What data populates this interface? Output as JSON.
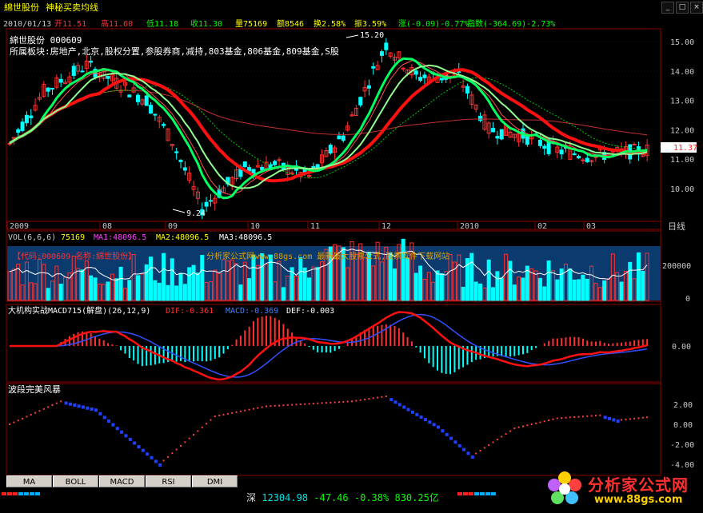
{
  "header": {
    "stock_name": "綿世股份",
    "formula_name": "神秘买卖均线",
    "window_buttons": [
      "_",
      "□",
      "×"
    ]
  },
  "quote_line": {
    "date": "2010/01/13",
    "open": "开11.51",
    "high": "高11.60",
    "low": "低11.18",
    "close": "收11.30",
    "volume": "量75169",
    "amount": "额8546",
    "turnover": "换2.58%",
    "amplitude": "振3.59%",
    "change": "涨(-0.09)-0.77%",
    "index": "指数(-364.69)-2.73%"
  },
  "info_overlay": {
    "code_line": "綿世股份 000609",
    "sector_line": "所属板块:房地产,北京,股权分置,参股券商,减持,803基金,806基金,809基金,S股"
  },
  "main_chart": {
    "price_axis": [
      "15.00",
      "14.00",
      "13.00",
      "12.00",
      "11.00",
      "10.00"
    ],
    "current_price": "11.37",
    "high_marker": "15.20",
    "low_marker": "9.24",
    "month_labels": [
      "2009",
      "08",
      "09",
      "10",
      "11",
      "12",
      "2010",
      "02",
      "03"
    ],
    "period_label": "日线"
  },
  "vol_panel": {
    "title": "VOL(6,6,6)",
    "value": "75169",
    "ma1": "MA1:48096.5",
    "ma2": "MA2:48096.5",
    "ma3": "MA3:48096.5",
    "axis": [
      "200000",
      "0"
    ],
    "code_label": "【代码:000609 名称:綿世股份】",
    "ad_text": "分析家公式网www.88gs.com 最新最大股票公式,股票软件下载网站"
  },
  "macd_panel": {
    "title": "大机构实战MACD715(解盘)(26,12,9)",
    "dif": "DIF:-0.361",
    "macd": "MACD:-0.369",
    "def": "DEF:-0.003",
    "axis": [
      "0.00"
    ]
  },
  "wave_panel": {
    "title": "波段完美风暴",
    "axis": [
      "2.00",
      "0.00",
      "-2.00",
      "-4.00"
    ]
  },
  "bottom_tabs": [
    "MA",
    "BOLL",
    "MACD",
    "RSI",
    "DMI"
  ],
  "status_bar": {
    "market": "深",
    "index_value": "12304.98",
    "change": "-47.46",
    "percent": "-0.38%",
    "amount": "830.25亿"
  },
  "logo": {
    "name": "分析家公式网",
    "url": "www.88gs.com"
  },
  "colors": {
    "up": "#ff3030",
    "down": "#00ffff",
    "grid": "#8b0000",
    "line_green": "#00ff60",
    "line_red": "#ff1010",
    "vol_bg": "#0b3b6e"
  }
}
